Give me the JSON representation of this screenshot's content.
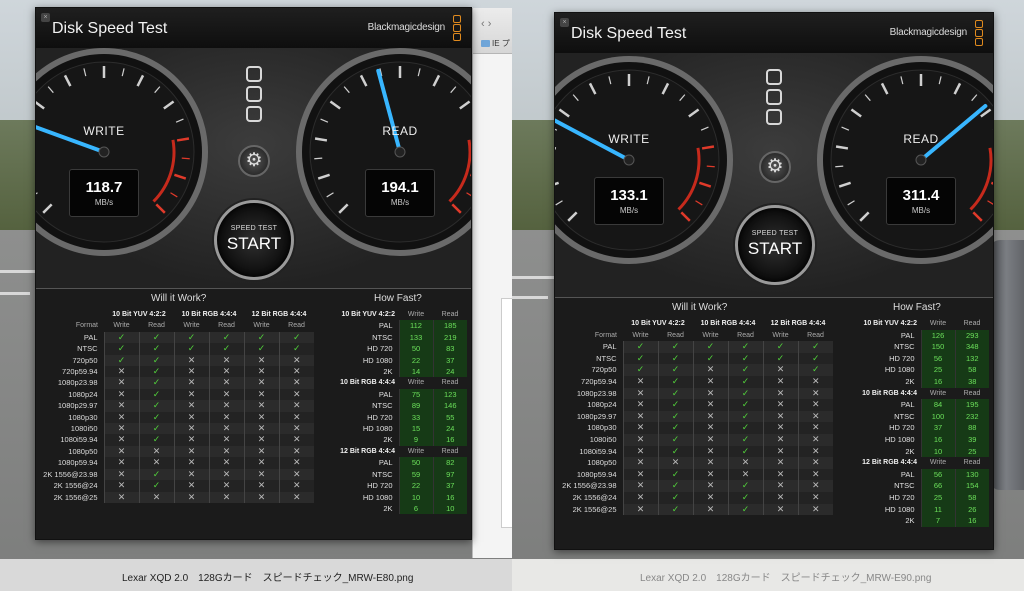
{
  "colors": {
    "accent_needle": "#38b6ff",
    "check_green": "#51d23b",
    "brand_orange": "#e08a1e"
  },
  "screens": [
    {
      "app_title": "Disk Speed Test",
      "brand": "Blackmagicdesign",
      "caption": "Lexar XQD 2.0　128Gカード　スピードチェック_MRW-E80.png",
      "finder_item": "IE プ",
      "write": {
        "label": "WRITE",
        "value": "118.7",
        "unit": "MB/s",
        "needle_angle": -70
      },
      "read": {
        "label": "READ",
        "value": "194.1",
        "unit": "MB/s",
        "needle_angle": -15
      },
      "start": {
        "sub": "SPEED TEST",
        "main": "START"
      },
      "will_title": "Will it Work?",
      "fast_title": "How Fast?",
      "will": {
        "groups": [
          "10 Bit YUV 4:2:2",
          "10 Bit RGB 4:4:4",
          "12 Bit RGB 4:4:4"
        ],
        "format_head": "Format",
        "write_head": "Write",
        "read_head": "Read",
        "rows": [
          {
            "format": "PAL",
            "marks": [
              1,
              1,
              1,
              1,
              1,
              1
            ]
          },
          {
            "format": "NTSC",
            "marks": [
              1,
              1,
              1,
              1,
              1,
              1
            ]
          },
          {
            "format": "720p50",
            "marks": [
              1,
              1,
              0,
              0,
              0,
              0
            ]
          },
          {
            "format": "720p59.94",
            "marks": [
              0,
              1,
              0,
              0,
              0,
              0
            ]
          },
          {
            "format": "1080p23.98",
            "marks": [
              0,
              1,
              0,
              0,
              0,
              0
            ]
          },
          {
            "format": "1080p24",
            "marks": [
              0,
              1,
              0,
              0,
              0,
              0
            ]
          },
          {
            "format": "1080p29.97",
            "marks": [
              0,
              1,
              0,
              0,
              0,
              0
            ]
          },
          {
            "format": "1080p30",
            "marks": [
              0,
              1,
              0,
              0,
              0,
              0
            ]
          },
          {
            "format": "1080i50",
            "marks": [
              0,
              1,
              0,
              0,
              0,
              0
            ]
          },
          {
            "format": "1080i59.94",
            "marks": [
              0,
              1,
              0,
              0,
              0,
              0
            ]
          },
          {
            "format": "1080p50",
            "marks": [
              0,
              0,
              0,
              0,
              0,
              0
            ]
          },
          {
            "format": "1080p59.94",
            "marks": [
              0,
              0,
              0,
              0,
              0,
              0
            ]
          },
          {
            "format": "2K 1556@23.98",
            "marks": [
              0,
              1,
              0,
              0,
              0,
              0
            ]
          },
          {
            "format": "2K 1556@24",
            "marks": [
              0,
              1,
              0,
              0,
              0,
              0
            ]
          },
          {
            "format": "2K 1556@25",
            "marks": [
              0,
              0,
              0,
              0,
              0,
              0
            ]
          }
        ]
      },
      "fast": {
        "write_head": "Write",
        "read_head": "Read",
        "groups": [
          {
            "name": "10 Bit YUV 4:2:2",
            "rows": [
              [
                "PAL",
                "112",
                "185"
              ],
              [
                "NTSC",
                "133",
                "219"
              ],
              [
                "HD 720",
                "50",
                "83"
              ],
              [
                "HD 1080",
                "22",
                "37"
              ],
              [
                "2K",
                "14",
                "24"
              ]
            ]
          },
          {
            "name": "10 Bit RGB 4:4:4",
            "rows": [
              [
                "PAL",
                "75",
                "123"
              ],
              [
                "NTSC",
                "89",
                "146"
              ],
              [
                "HD 720",
                "33",
                "55"
              ],
              [
                "HD 1080",
                "15",
                "24"
              ],
              [
                "2K",
                "9",
                "16"
              ]
            ]
          },
          {
            "name": "12 Bit RGB 4:4:4",
            "rows": [
              [
                "PAL",
                "50",
                "82"
              ],
              [
                "NTSC",
                "59",
                "97"
              ],
              [
                "HD 720",
                "22",
                "37"
              ],
              [
                "HD 1080",
                "10",
                "16"
              ],
              [
                "2K",
                "6",
                "10"
              ]
            ]
          }
        ]
      }
    },
    {
      "app_title": "Disk Speed Test",
      "brand": "Blackmagicdesign",
      "caption": "Lexar XQD 2.0　128Gカード　スピードチェック_MRW-E90.png",
      "write": {
        "label": "WRITE",
        "value": "133.1",
        "unit": "MB/s",
        "needle_angle": -62
      },
      "read": {
        "label": "READ",
        "value": "311.4",
        "unit": "MB/s",
        "needle_angle": 50
      },
      "start": {
        "sub": "SPEED TEST",
        "main": "START"
      },
      "will_title": "Will it Work?",
      "fast_title": "How Fast?",
      "will": {
        "groups": [
          "10 Bit YUV 4:2:2",
          "10 Bit RGB 4:4:4",
          "12 Bit RGB 4:4:4"
        ],
        "format_head": "Format",
        "write_head": "Write",
        "read_head": "Read",
        "rows": [
          {
            "format": "PAL",
            "marks": [
              1,
              1,
              1,
              1,
              1,
              1
            ]
          },
          {
            "format": "NTSC",
            "marks": [
              1,
              1,
              1,
              1,
              1,
              1
            ]
          },
          {
            "format": "720p50",
            "marks": [
              1,
              1,
              0,
              1,
              0,
              1
            ]
          },
          {
            "format": "720p59.94",
            "marks": [
              0,
              1,
              0,
              1,
              0,
              0
            ]
          },
          {
            "format": "1080p23.98",
            "marks": [
              0,
              1,
              0,
              1,
              0,
              0
            ]
          },
          {
            "format": "1080p24",
            "marks": [
              0,
              1,
              0,
              1,
              0,
              0
            ]
          },
          {
            "format": "1080p29.97",
            "marks": [
              0,
              1,
              0,
              1,
              0,
              0
            ]
          },
          {
            "format": "1080p30",
            "marks": [
              0,
              1,
              0,
              1,
              0,
              0
            ]
          },
          {
            "format": "1080i50",
            "marks": [
              0,
              1,
              0,
              1,
              0,
              0
            ]
          },
          {
            "format": "1080i59.94",
            "marks": [
              0,
              1,
              0,
              1,
              0,
              0
            ]
          },
          {
            "format": "1080p50",
            "marks": [
              0,
              0,
              0,
              0,
              0,
              0
            ]
          },
          {
            "format": "1080p59.94",
            "marks": [
              0,
              1,
              0,
              0,
              0,
              0
            ]
          },
          {
            "format": "2K 1556@23.98",
            "marks": [
              0,
              1,
              0,
              1,
              0,
              0
            ]
          },
          {
            "format": "2K 1556@24",
            "marks": [
              0,
              1,
              0,
              1,
              0,
              0
            ]
          },
          {
            "format": "2K 1556@25",
            "marks": [
              0,
              1,
              0,
              1,
              0,
              0
            ]
          }
        ]
      },
      "fast": {
        "write_head": "Write",
        "read_head": "Read",
        "groups": [
          {
            "name": "10 Bit YUV 4:2:2",
            "rows": [
              [
                "PAL",
                "126",
                "293"
              ],
              [
                "NTSC",
                "150",
                "348"
              ],
              [
                "HD 720",
                "56",
                "132"
              ],
              [
                "HD 1080",
                "25",
                "58"
              ],
              [
                "2K",
                "16",
                "38"
              ]
            ]
          },
          {
            "name": "10 Bit RGB 4:4:4",
            "rows": [
              [
                "PAL",
                "84",
                "195"
              ],
              [
                "NTSC",
                "100",
                "232"
              ],
              [
                "HD 720",
                "37",
                "88"
              ],
              [
                "HD 1080",
                "16",
                "39"
              ],
              [
                "2K",
                "10",
                "25"
              ]
            ]
          },
          {
            "name": "12 Bit RGB 4:4:4",
            "rows": [
              [
                "PAL",
                "56",
                "130"
              ],
              [
                "NTSC",
                "66",
                "154"
              ],
              [
                "HD 720",
                "25",
                "58"
              ],
              [
                "HD 1080",
                "11",
                "26"
              ],
              [
                "2K",
                "7",
                "16"
              ]
            ]
          }
        ]
      }
    }
  ]
}
